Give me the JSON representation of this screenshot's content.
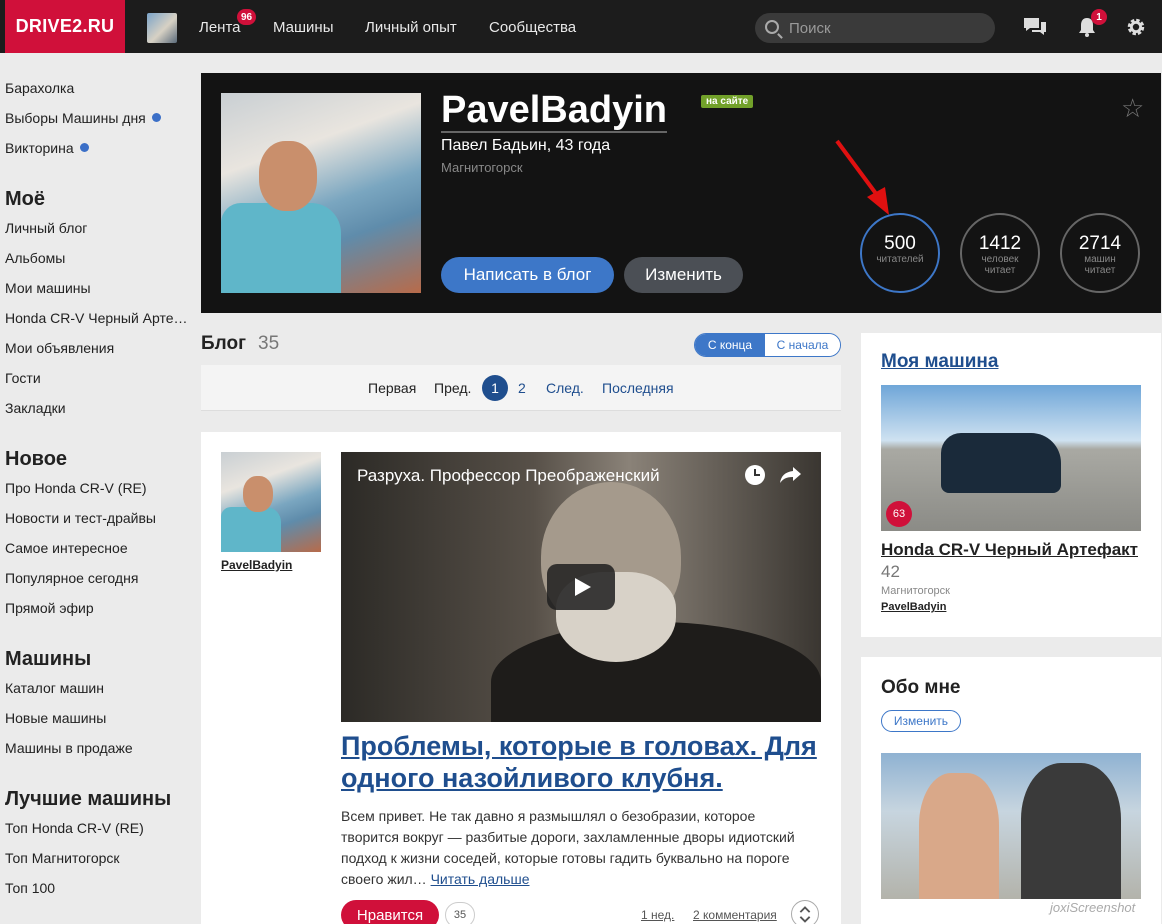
{
  "topbar": {
    "logo": "DRIVE2.RU",
    "nav": [
      {
        "label": "Лента",
        "badge": "96"
      },
      {
        "label": "Машины"
      },
      {
        "label": "Личный опыт"
      },
      {
        "label": "Сообщества"
      }
    ],
    "search_placeholder": "Поиск",
    "notifications_badge": "1"
  },
  "sidebar": {
    "top_items": [
      "Барахолка",
      "Выборы Машины дня",
      "Викторина"
    ],
    "sections": [
      {
        "title": "Моё",
        "items": [
          "Личный блог",
          "Альбомы",
          "Мои машины",
          "Honda CR-V Черный Арте…",
          "Мои объявления",
          "Гости",
          "Закладки"
        ]
      },
      {
        "title": "Новое",
        "items": [
          "Про Honda CR-V (RE)",
          "Новости и тест-драйвы",
          "Самое интересное",
          "Популярное сегодня",
          "Прямой эфир"
        ]
      },
      {
        "title": "Машины",
        "items": [
          "Каталог машин",
          "Новые машины",
          "Машины в продаже"
        ]
      },
      {
        "title": "Лучшие машины",
        "items": [
          "Топ Honda CR-V (RE)",
          "Топ Магнитогорск",
          "Топ 100"
        ]
      }
    ]
  },
  "profile": {
    "username": "PavelBadyin",
    "online_label": "на сайте",
    "full_name_age": "Павел Бадьин, 43 года",
    "city": "Магнитогорск",
    "write_button": "Написать в блог",
    "edit_button": "Изменить",
    "stats": [
      {
        "value": "500",
        "label": "читателей"
      },
      {
        "value": "1412",
        "label_1": "человек",
        "label_2": "читает"
      },
      {
        "value": "2714",
        "label_1": "машин",
        "label_2": "читает"
      }
    ]
  },
  "blog": {
    "title": "Блог",
    "count": "35",
    "sort_from_end": "С конца",
    "sort_from_start": "С начала",
    "pager": {
      "first": "Первая",
      "prev": "Пред.",
      "current": "1",
      "next_page": "2",
      "next": "След.",
      "last": "Последняя"
    }
  },
  "post": {
    "author": "PavelBadyin",
    "video_title": "Разруха. Профессор Преображенский",
    "title": "Проблемы, которые в головах. Для одного назойливого клубня.",
    "text": "Всем привет. Не так давно я размышлял о безобразии, которое творится вокруг — разбитые дороги, захламленные дворы идиотский подход к жизни соседей, которые готовы гадить буквально на пороге своего жил…",
    "read_more": "Читать дальше",
    "like_label": "Нравится",
    "like_count": "35",
    "time_ago": "1 нед.",
    "comments": "2 комментария"
  },
  "my_car": {
    "section_title": "Моя машина",
    "badge": "63",
    "name": "Honda CR-V Черный Артефакт",
    "count": "42",
    "city": "Магнитогорск",
    "owner": "PavelBadyin"
  },
  "about": {
    "title": "Обо мне",
    "edit_button": "Изменить"
  },
  "watermark": "joxiScreenshot",
  "colors": {
    "brand": "#d0103a",
    "accent": "#3d77c8",
    "link": "#1f4e8e"
  }
}
